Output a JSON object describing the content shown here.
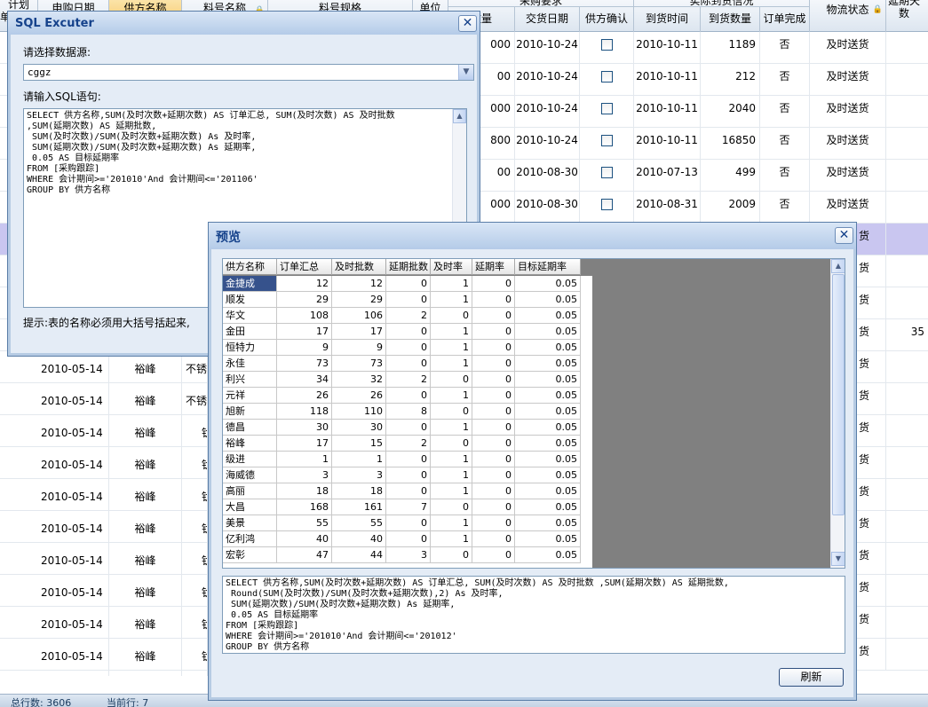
{
  "background": {
    "header_top": [
      "计划",
      "申购日期",
      "供方名称",
      "料号名称",
      "料号规格",
      "单位",
      "采购要求",
      "实际到货信况",
      "物流状态",
      "延期天数"
    ],
    "header_sub": [
      "数量",
      "交货日期",
      "供方确认",
      "到货时间",
      "到货数量",
      "订单完成"
    ],
    "header_extra": "单",
    "rows": [
      {
        "qty": "000",
        "deliv": "2010-10-24",
        "arrive": "2010-10-11",
        "arrived_qty": "1189",
        "done": "否",
        "logistics": "及时送货"
      },
      {
        "qty": "00",
        "deliv": "2010-10-24",
        "arrive": "2010-10-11",
        "arrived_qty": "212",
        "done": "否",
        "logistics": "及时送货"
      },
      {
        "qty": "000",
        "deliv": "2010-10-24",
        "arrive": "2010-10-11",
        "arrived_qty": "2040",
        "done": "否",
        "logistics": "及时送货"
      },
      {
        "qty": "800",
        "deliv": "2010-10-24",
        "arrive": "2010-10-11",
        "arrived_qty": "16850",
        "done": "否",
        "logistics": "及时送货"
      },
      {
        "qty": "00",
        "deliv": "2010-08-30",
        "arrive": "2010-07-13",
        "arrived_qty": "499",
        "done": "否",
        "logistics": "及时送货"
      },
      {
        "qty": "000",
        "deliv": "2010-08-30",
        "arrive": "2010-08-31",
        "arrived_qty": "2009",
        "done": "否",
        "logistics": "及时送货"
      }
    ],
    "right_col_partial": [
      "货",
      "货",
      "货",
      "货",
      "货",
      "货",
      "货",
      "货",
      "货",
      "货",
      "货",
      "货",
      "货",
      "货"
    ],
    "delay_value": "35",
    "lower_rows": [
      {
        "date": "2010-05-14",
        "supplier": "裕峰",
        "item": "不锈"
      },
      {
        "date": "2010-05-14",
        "supplier": "裕峰",
        "item": "不锈"
      },
      {
        "date": "2010-05-14",
        "supplier": "裕峰",
        "item": "钛"
      },
      {
        "date": "2010-05-14",
        "supplier": "裕峰",
        "item": "钛"
      },
      {
        "date": "2010-05-14",
        "supplier": "裕峰",
        "item": "钛"
      },
      {
        "date": "2010-05-14",
        "supplier": "裕峰",
        "item": "钛"
      },
      {
        "date": "2010-05-14",
        "supplier": "裕峰",
        "item": "钛"
      },
      {
        "date": "2010-05-14",
        "supplier": "裕峰",
        "item": "钛"
      },
      {
        "date": "2010-05-14",
        "supplier": "裕峰",
        "item": "钛"
      },
      {
        "date": "2010-05-14",
        "supplier": "裕峰",
        "item": "钛"
      }
    ],
    "status": {
      "total_label": "总行数: 3606",
      "current_label": "当前行: 7"
    }
  },
  "sql_dialog": {
    "title": "SQL Excuter",
    "select_source_label": "请选择数据源:",
    "source_value": "cggz",
    "input_label": "请输入SQL语句:",
    "sql": "SELECT 供方名称,SUM(及时次数+延期次数) AS 订单汇总, SUM(及时次数) AS 及时批数\n,SUM(延期次数) AS 延期批数,\n SUM(及时次数)/SUM(及时次数+延期次数) As 及时率,\n SUM(延期次数)/SUM(及时次数+延期次数) As 延期率,\n 0.05 AS 目标延期率\nFROM [采购跟踪]\nWHERE 会计期间>='201010'And 会计期间<='201106'\nGROUP BY 供方名称",
    "hint": "提示:表的名称必须用大括号括起来,"
  },
  "preview_dialog": {
    "title": "预览",
    "columns": [
      "供方名称",
      "订单汇总",
      "及时批数",
      "延期批数",
      "及时率",
      "延期率",
      "目标延期率"
    ],
    "rows": [
      [
        "金捷成",
        "12",
        "12",
        "0",
        "1",
        "0",
        "0.05"
      ],
      [
        "顺发",
        "29",
        "29",
        "0",
        "1",
        "0",
        "0.05"
      ],
      [
        "华文",
        "108",
        "106",
        "2",
        "0",
        "0",
        "0.05"
      ],
      [
        "金田",
        "17",
        "17",
        "0",
        "1",
        "0",
        "0.05"
      ],
      [
        "恒特力",
        "9",
        "9",
        "0",
        "1",
        "0",
        "0.05"
      ],
      [
        "永佳",
        "73",
        "73",
        "0",
        "1",
        "0",
        "0.05"
      ],
      [
        "利兴",
        "34",
        "32",
        "2",
        "0",
        "0",
        "0.05"
      ],
      [
        "元祥",
        "26",
        "26",
        "0",
        "1",
        "0",
        "0.05"
      ],
      [
        "旭新",
        "118",
        "110",
        "8",
        "0",
        "0",
        "0.05"
      ],
      [
        "德昌",
        "30",
        "30",
        "0",
        "1",
        "0",
        "0.05"
      ],
      [
        "裕峰",
        "17",
        "15",
        "2",
        "0",
        "0",
        "0.05"
      ],
      [
        "级进",
        "1",
        "1",
        "0",
        "1",
        "0",
        "0.05"
      ],
      [
        "海威德",
        "3",
        "3",
        "0",
        "1",
        "0",
        "0.05"
      ],
      [
        "高丽",
        "18",
        "18",
        "0",
        "1",
        "0",
        "0.05"
      ],
      [
        "大昌",
        "168",
        "161",
        "7",
        "0",
        "0",
        "0.05"
      ],
      [
        "美景",
        "55",
        "55",
        "0",
        "1",
        "0",
        "0.05"
      ],
      [
        "亿利鸿",
        "40",
        "40",
        "0",
        "1",
        "0",
        "0.05"
      ],
      [
        "宏彰",
        "47",
        "44",
        "3",
        "0",
        "0",
        "0.05"
      ]
    ],
    "sql": "SELECT 供方名称,SUM(及时次数+延期次数) AS 订单汇总, SUM(及时次数) AS 及时批数 ,SUM(延期次数) AS 延期批数,\n Round(SUM(及时次数)/SUM(及时次数+延期次数),2) As 及时率,\n SUM(延期次数)/SUM(及时次数+延期次数) As 延期率,\n 0.05 AS 目标延期率\nFROM [采购跟踪]\nWHERE 会计期间>='201010'And 会计期间<='201012'\nGROUP BY 供方名称",
    "refresh_label": "刷新"
  }
}
